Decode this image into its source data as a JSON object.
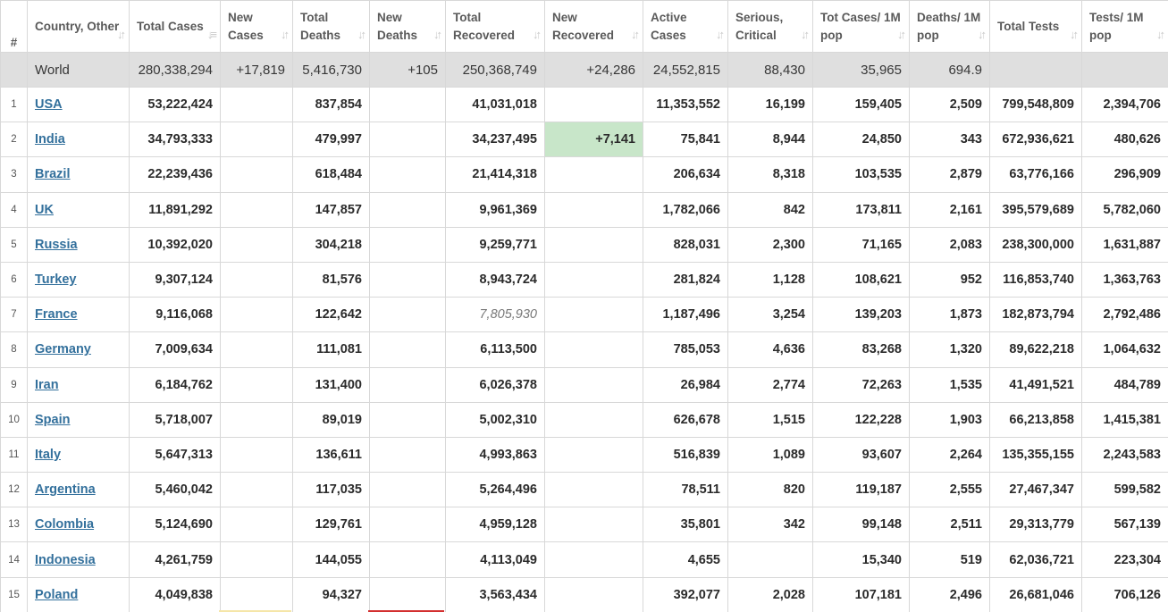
{
  "colors": {
    "header_text": "#5a5a5a",
    "world_row_bg": "#dfdfdf",
    "link": "#33709c",
    "new_recovered_highlight": "#c8e6c9",
    "new_cases_marker": "#f5e6a8",
    "new_deaths_marker": "#d32f2f"
  },
  "columns": [
    {
      "key": "rank",
      "label": "#"
    },
    {
      "key": "country",
      "label": "Country, Other",
      "sort_icon": "sort-arrows-icon"
    },
    {
      "key": "total_cases",
      "label": "Total Cases",
      "sort_icon": "sort-desc-icon"
    },
    {
      "key": "new_cases",
      "label": "New Cases",
      "sort_icon": "sort-arrows-icon"
    },
    {
      "key": "total_deaths",
      "label": "Total Deaths",
      "sort_icon": "sort-arrows-icon"
    },
    {
      "key": "new_deaths",
      "label": "New Deaths",
      "sort_icon": "sort-arrows-icon"
    },
    {
      "key": "total_recovered",
      "label": "Total Recovered",
      "sort_icon": "sort-arrows-icon"
    },
    {
      "key": "new_recovered",
      "label": "New Recovered",
      "sort_icon": "sort-arrows-icon"
    },
    {
      "key": "active_cases",
      "label": "Active Cases",
      "sort_icon": "sort-arrows-icon"
    },
    {
      "key": "serious_critical",
      "label": "Serious, Critical",
      "sort_icon": "sort-arrows-icon"
    },
    {
      "key": "cases_per_1m",
      "label": "Tot Cases/ 1M pop",
      "sort_icon": "sort-arrows-icon"
    },
    {
      "key": "deaths_per_1m",
      "label": "Deaths/ 1M pop",
      "sort_icon": "sort-arrows-icon"
    },
    {
      "key": "total_tests",
      "label": "Total Tests",
      "sort_icon": "sort-arrows-icon"
    },
    {
      "key": "tests_per_1m",
      "label": "Tests/ 1M pop",
      "sort_icon": "sort-arrows-icon"
    }
  ],
  "world": {
    "rank": "",
    "country": "World",
    "total_cases": "280,338,294",
    "new_cases": "+17,819",
    "total_deaths": "5,416,730",
    "new_deaths": "+105",
    "total_recovered": "250,368,749",
    "new_recovered": "+24,286",
    "active_cases": "24,552,815",
    "serious_critical": "88,430",
    "cases_per_1m": "35,965",
    "deaths_per_1m": "694.9",
    "total_tests": "",
    "tests_per_1m": ""
  },
  "rows": [
    {
      "rank": "1",
      "country": "USA",
      "total_cases": "53,222,424",
      "new_cases": "",
      "total_deaths": "837,854",
      "new_deaths": "",
      "total_recovered": "41,031,018",
      "new_recovered": "",
      "active_cases": "11,353,552",
      "serious_critical": "16,199",
      "cases_per_1m": "159,405",
      "deaths_per_1m": "2,509",
      "total_tests": "799,548,809",
      "tests_per_1m": "2,394,706"
    },
    {
      "rank": "2",
      "country": "India",
      "total_cases": "34,793,333",
      "new_cases": "",
      "total_deaths": "479,997",
      "new_deaths": "",
      "total_recovered": "34,237,495",
      "new_recovered": "+7,141",
      "active_cases": "75,841",
      "serious_critical": "8,944",
      "cases_per_1m": "24,850",
      "deaths_per_1m": "343",
      "total_tests": "672,936,621",
      "tests_per_1m": "480,626"
    },
    {
      "rank": "3",
      "country": "Brazil",
      "total_cases": "22,239,436",
      "new_cases": "",
      "total_deaths": "618,484",
      "new_deaths": "",
      "total_recovered": "21,414,318",
      "new_recovered": "",
      "active_cases": "206,634",
      "serious_critical": "8,318",
      "cases_per_1m": "103,535",
      "deaths_per_1m": "2,879",
      "total_tests": "63,776,166",
      "tests_per_1m": "296,909"
    },
    {
      "rank": "4",
      "country": "UK",
      "total_cases": "11,891,292",
      "new_cases": "",
      "total_deaths": "147,857",
      "new_deaths": "",
      "total_recovered": "9,961,369",
      "new_recovered": "",
      "active_cases": "1,782,066",
      "serious_critical": "842",
      "cases_per_1m": "173,811",
      "deaths_per_1m": "2,161",
      "total_tests": "395,579,689",
      "tests_per_1m": "5,782,060"
    },
    {
      "rank": "5",
      "country": "Russia",
      "total_cases": "10,392,020",
      "new_cases": "",
      "total_deaths": "304,218",
      "new_deaths": "",
      "total_recovered": "9,259,771",
      "new_recovered": "",
      "active_cases": "828,031",
      "serious_critical": "2,300",
      "cases_per_1m": "71,165",
      "deaths_per_1m": "2,083",
      "total_tests": "238,300,000",
      "tests_per_1m": "1,631,887"
    },
    {
      "rank": "6",
      "country": "Turkey",
      "total_cases": "9,307,124",
      "new_cases": "",
      "total_deaths": "81,576",
      "new_deaths": "",
      "total_recovered": "8,943,724",
      "new_recovered": "",
      "active_cases": "281,824",
      "serious_critical": "1,128",
      "cases_per_1m": "108,621",
      "deaths_per_1m": "952",
      "total_tests": "116,853,740",
      "tests_per_1m": "1,363,763"
    },
    {
      "rank": "7",
      "country": "France",
      "total_cases": "9,116,068",
      "new_cases": "",
      "total_deaths": "122,642",
      "new_deaths": "",
      "total_recovered": "7,805,930",
      "new_recovered": "",
      "active_cases": "1,187,496",
      "serious_critical": "3,254",
      "cases_per_1m": "139,203",
      "deaths_per_1m": "1,873",
      "total_tests": "182,873,794",
      "tests_per_1m": "2,792,486"
    },
    {
      "rank": "8",
      "country": "Germany",
      "total_cases": "7,009,634",
      "new_cases": "",
      "total_deaths": "111,081",
      "new_deaths": "",
      "total_recovered": "6,113,500",
      "new_recovered": "",
      "active_cases": "785,053",
      "serious_critical": "4,636",
      "cases_per_1m": "83,268",
      "deaths_per_1m": "1,320",
      "total_tests": "89,622,218",
      "tests_per_1m": "1,064,632"
    },
    {
      "rank": "9",
      "country": "Iran",
      "total_cases": "6,184,762",
      "new_cases": "",
      "total_deaths": "131,400",
      "new_deaths": "",
      "total_recovered": "6,026,378",
      "new_recovered": "",
      "active_cases": "26,984",
      "serious_critical": "2,774",
      "cases_per_1m": "72,263",
      "deaths_per_1m": "1,535",
      "total_tests": "41,491,521",
      "tests_per_1m": "484,789"
    },
    {
      "rank": "10",
      "country": "Spain",
      "total_cases": "5,718,007",
      "new_cases": "",
      "total_deaths": "89,019",
      "new_deaths": "",
      "total_recovered": "5,002,310",
      "new_recovered": "",
      "active_cases": "626,678",
      "serious_critical": "1,515",
      "cases_per_1m": "122,228",
      "deaths_per_1m": "1,903",
      "total_tests": "66,213,858",
      "tests_per_1m": "1,415,381"
    },
    {
      "rank": "11",
      "country": "Italy",
      "total_cases": "5,647,313",
      "new_cases": "",
      "total_deaths": "136,611",
      "new_deaths": "",
      "total_recovered": "4,993,863",
      "new_recovered": "",
      "active_cases": "516,839",
      "serious_critical": "1,089",
      "cases_per_1m": "93,607",
      "deaths_per_1m": "2,264",
      "total_tests": "135,355,155",
      "tests_per_1m": "2,243,583"
    },
    {
      "rank": "12",
      "country": "Argentina",
      "total_cases": "5,460,042",
      "new_cases": "",
      "total_deaths": "117,035",
      "new_deaths": "",
      "total_recovered": "5,264,496",
      "new_recovered": "",
      "active_cases": "78,511",
      "serious_critical": "820",
      "cases_per_1m": "119,187",
      "deaths_per_1m": "2,555",
      "total_tests": "27,467,347",
      "tests_per_1m": "599,582"
    },
    {
      "rank": "13",
      "country": "Colombia",
      "total_cases": "5,124,690",
      "new_cases": "",
      "total_deaths": "129,761",
      "new_deaths": "",
      "total_recovered": "4,959,128",
      "new_recovered": "",
      "active_cases": "35,801",
      "serious_critical": "342",
      "cases_per_1m": "99,148",
      "deaths_per_1m": "2,511",
      "total_tests": "29,313,779",
      "tests_per_1m": "567,139"
    },
    {
      "rank": "14",
      "country": "Indonesia",
      "total_cases": "4,261,759",
      "new_cases": "",
      "total_deaths": "144,055",
      "new_deaths": "",
      "total_recovered": "4,113,049",
      "new_recovered": "",
      "active_cases": "4,655",
      "serious_critical": "",
      "cases_per_1m": "15,340",
      "deaths_per_1m": "519",
      "total_tests": "62,036,721",
      "tests_per_1m": "223,304"
    },
    {
      "rank": "15",
      "country": "Poland",
      "total_cases": "4,049,838",
      "new_cases": "",
      "total_deaths": "94,327",
      "new_deaths": "",
      "total_recovered": "3,563,434",
      "new_recovered": "",
      "active_cases": "392,077",
      "serious_critical": "2,028",
      "cases_per_1m": "107,181",
      "deaths_per_1m": "2,496",
      "total_tests": "26,681,046",
      "tests_per_1m": "706,126"
    }
  ]
}
